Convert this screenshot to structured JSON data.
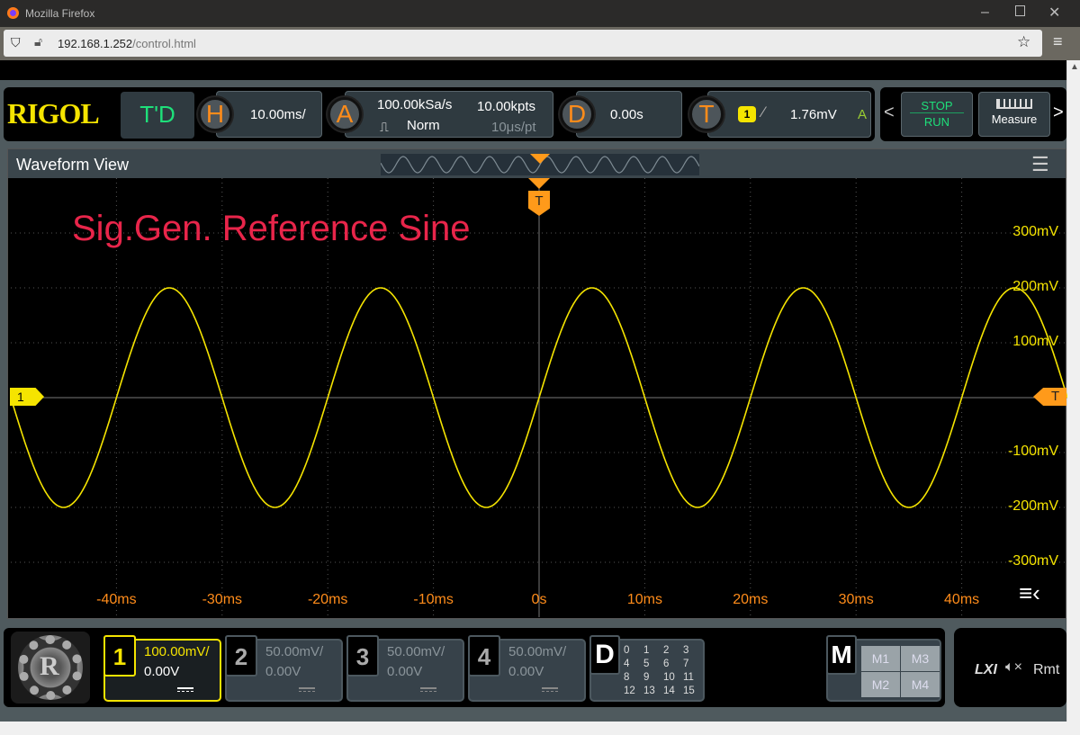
{
  "browser": {
    "title": "Mozilla Firefox",
    "url_host": "192.168.1.252",
    "url_path": "/control.html"
  },
  "toolbar": {
    "logo": "RIGOL",
    "td_label": "T'D",
    "h_label": "H",
    "timebase": "10.00ms/",
    "a_label": "A",
    "sample_rate": "100.00kSa/s",
    "mem_depth": "10.00kpts",
    "acq_mode": "Norm",
    "time_per_pt": "10μs/pt",
    "d_label": "D",
    "delay": "0.00s",
    "t_label": "T",
    "trig_source": "1",
    "trig_level": "1.76mV",
    "trig_status": "A",
    "stop": "STOP",
    "run": "RUN",
    "measure": "Measure",
    "prev": "<",
    "next": ">"
  },
  "waveform": {
    "title": "Waveform View",
    "annotation": "Sig.Gen. Reference Sine",
    "trigger_marker": "T",
    "channel_marker": "1",
    "trig_level_marker": "T",
    "x_ticks": [
      "-40ms",
      "-30ms",
      "-20ms",
      "-10ms",
      "0s",
      "10ms",
      "20ms",
      "30ms",
      "40ms"
    ],
    "y_ticks": [
      "300mV",
      "200mV",
      "100mV",
      "-100mV",
      "-200mV",
      "-300mV"
    ],
    "signal": {
      "amplitude_mV": 200,
      "period_ms": 20,
      "color": "#f5e400"
    }
  },
  "channels": [
    {
      "num": "1",
      "scale": "100.00mV/",
      "offset": "0.00V",
      "active": true
    },
    {
      "num": "2",
      "scale": "50.00mV/",
      "offset": "0.00V",
      "active": false
    },
    {
      "num": "3",
      "scale": "50.00mV/",
      "offset": "0.00V",
      "active": false
    },
    {
      "num": "4",
      "scale": "50.00mV/",
      "offset": "0.00V",
      "active": false
    }
  ],
  "digital": {
    "label": "D",
    "bits": [
      "0",
      "1",
      "2",
      "3",
      "4",
      "5",
      "6",
      "7",
      "8",
      "9",
      "10",
      "11",
      "12",
      "13",
      "14",
      "15"
    ]
  },
  "math": {
    "label": "M",
    "items": [
      "M1",
      "M3",
      "M2",
      "M4"
    ]
  },
  "status": {
    "lxi": "LXI",
    "rmt": "Rmt"
  }
}
